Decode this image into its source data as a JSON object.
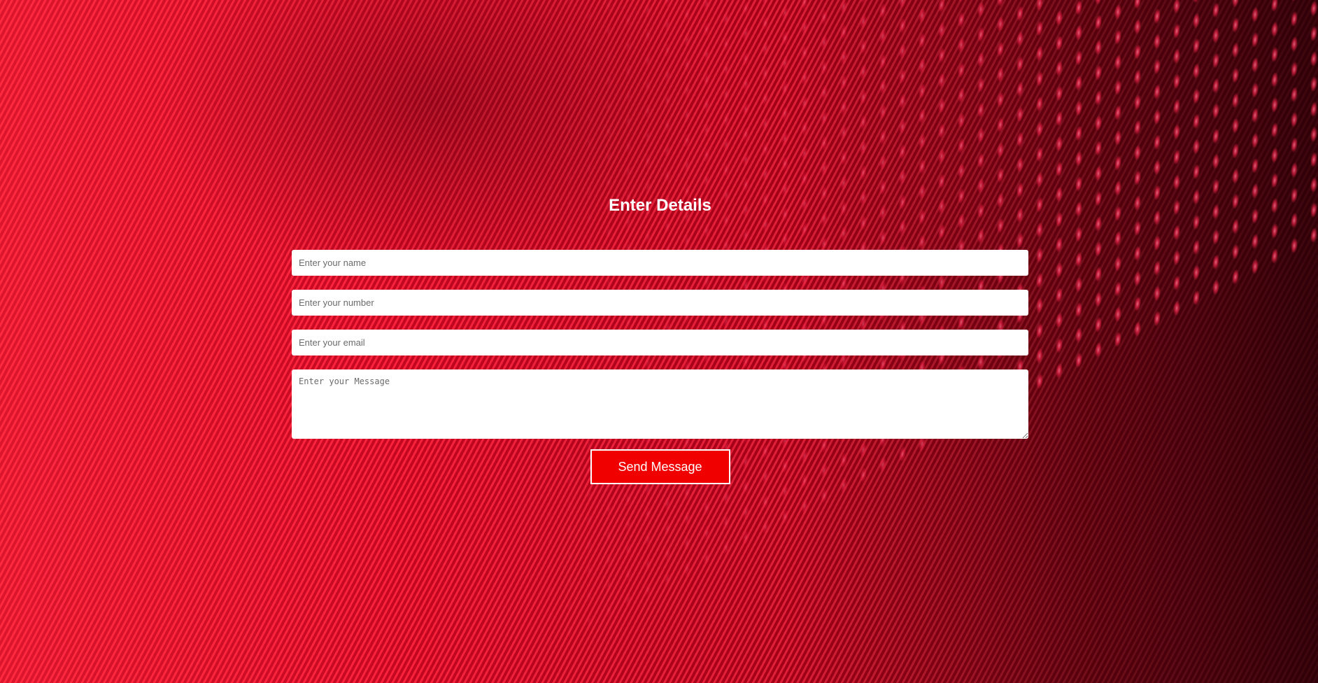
{
  "form": {
    "title": "Enter Details",
    "name_placeholder": "Enter your name",
    "number_placeholder": "Enter your number",
    "email_placeholder": "Enter your email",
    "message_placeholder": "Enter your Message",
    "send_label": "Send Message"
  },
  "colors": {
    "background": "#d50a22",
    "button": "#f10000",
    "text_on_red": "#ffffff"
  }
}
